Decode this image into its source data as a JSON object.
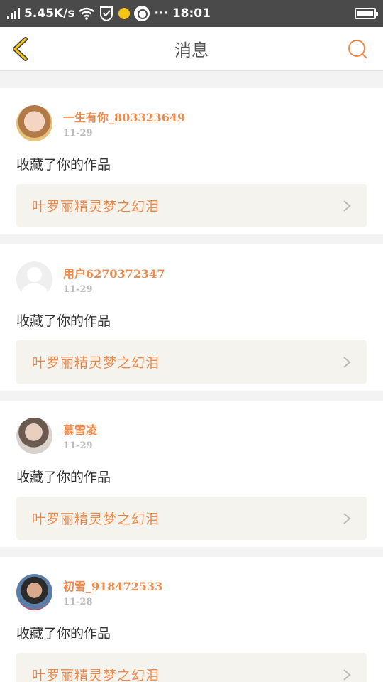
{
  "status_bar": {
    "network_speed": "5.45K/s",
    "time": "18:01",
    "more": "···",
    "icons": [
      "signal-icon",
      "wifi-icon",
      "shield-icon",
      "notification-dot-icon",
      "q-app-icon",
      "battery-icon"
    ]
  },
  "header": {
    "title": "消息",
    "back_icon": "chevron-left-icon",
    "search_icon": "search-icon",
    "accent_color": "#f08a4b",
    "back_color": "#f5c518"
  },
  "messages": [
    {
      "username": "一生有你_803323649",
      "date": "11-29",
      "action": "收藏了你的作品",
      "work": "叶罗丽精灵梦之幻泪"
    },
    {
      "username": "用户6270372347",
      "date": "11-29",
      "action": "收藏了你的作品",
      "work": "叶罗丽精灵梦之幻泪"
    },
    {
      "username": "慕雪凌",
      "date": "11-29",
      "action": "收藏了你的作品",
      "work": "叶罗丽精灵梦之幻泪"
    },
    {
      "username": "初雪_918472533",
      "date": "11-28",
      "action": "收藏了你的作品",
      "work": "叶罗丽精灵梦之幻泪"
    }
  ]
}
